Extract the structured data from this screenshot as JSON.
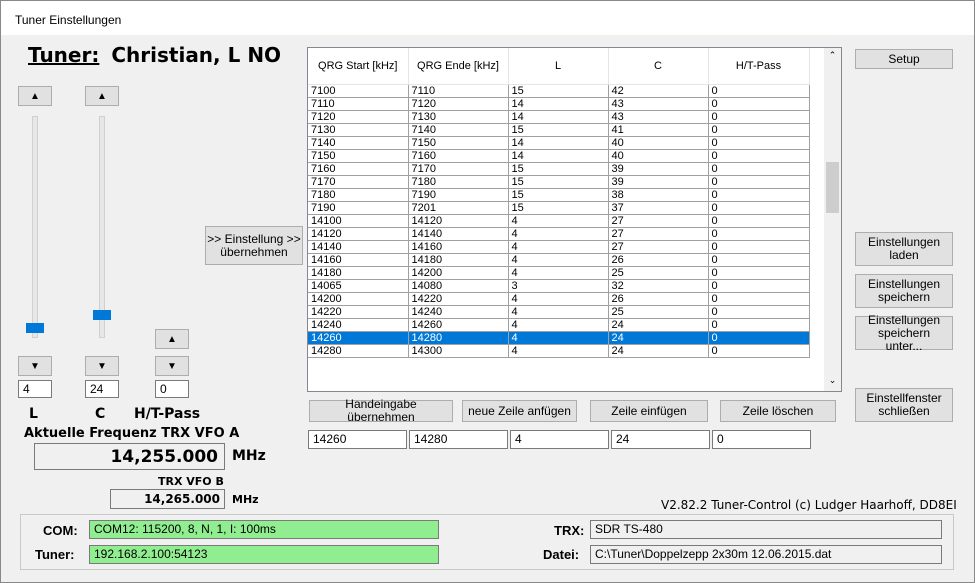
{
  "window": {
    "title": "Tuner Einstellungen"
  },
  "tuner": {
    "label": "Tuner:",
    "name": "Christian, L NO"
  },
  "sliders": {
    "l_value": "4",
    "c_value": "24",
    "htpass_value": "0",
    "l_label": "L",
    "c_label": "C",
    "htpass_label": "H/T-Pass",
    "up_glyph": "▲",
    "down_glyph": "▼"
  },
  "frequency": {
    "vfo_a_label": "Aktuelle Frequenz TRX VFO A",
    "vfo_a_value": "14,255.000",
    "vfo_a_unit": "MHz",
    "vfo_b_label": "TRX VFO B",
    "vfo_b_value": "14,265.000",
    "vfo_b_unit": "MHz"
  },
  "buttons": {
    "apply_setting": ">> Einstellung >> übernehmen",
    "setup": "Setup",
    "load_settings": "Einstellungen laden",
    "save_settings": "Einstellungen speichern",
    "save_settings_as": "Einstellungen speichern unter...",
    "close_window": "Einstellfenster schließen",
    "apply_manual": "Handeingabe übernehmen",
    "append_row": "neue Zeile anfügen",
    "insert_row": "Zeile einfügen",
    "delete_row": "Zeile löschen"
  },
  "table": {
    "columns": [
      "QRG Start [kHz]",
      "QRG Ende [kHz]",
      "L",
      "C",
      "H/T-Pass"
    ],
    "rows": [
      [
        "7100",
        "7110",
        "15",
        "42",
        "0"
      ],
      [
        "7110",
        "7120",
        "14",
        "43",
        "0"
      ],
      [
        "7120",
        "7130",
        "14",
        "43",
        "0"
      ],
      [
        "7130",
        "7140",
        "15",
        "41",
        "0"
      ],
      [
        "7140",
        "7150",
        "14",
        "40",
        "0"
      ],
      [
        "7150",
        "7160",
        "14",
        "40",
        "0"
      ],
      [
        "7160",
        "7170",
        "15",
        "39",
        "0"
      ],
      [
        "7170",
        "7180",
        "15",
        "39",
        "0"
      ],
      [
        "7180",
        "7190",
        "15",
        "38",
        "0"
      ],
      [
        "7190",
        "7201",
        "15",
        "37",
        "0"
      ],
      [
        "14100",
        "14120",
        "4",
        "27",
        "0"
      ],
      [
        "14120",
        "14140",
        "4",
        "27",
        "0"
      ],
      [
        "14140",
        "14160",
        "4",
        "27",
        "0"
      ],
      [
        "14160",
        "14180",
        "4",
        "26",
        "0"
      ],
      [
        "14180",
        "14200",
        "4",
        "25",
        "0"
      ],
      [
        "14065",
        "14080",
        "3",
        "32",
        "0"
      ],
      [
        "14200",
        "14220",
        "4",
        "26",
        "0"
      ],
      [
        "14220",
        "14240",
        "4",
        "25",
        "0"
      ],
      [
        "14240",
        "14260",
        "4",
        "24",
        "0"
      ],
      [
        "14260",
        "14280",
        "4",
        "24",
        "0"
      ],
      [
        "14280",
        "14300",
        "4",
        "24",
        "0"
      ]
    ],
    "selected_row": 19
  },
  "edit_row": [
    "14260",
    "14280",
    "4",
    "24",
    "0"
  ],
  "version": "V2.82.2 Tuner-Control (c) Ludger Haarhoff, DD8EI",
  "status": {
    "com_label": "COM:",
    "com_value": "COM12: 115200, 8, N, 1,  I: 100ms",
    "tuner_label": "Tuner:",
    "tuner_value": "192.168.2.100:54123",
    "trx_label": "TRX:",
    "trx_value": "SDR TS-480",
    "file_label": "Datei:",
    "file_value": "C:\\Tuner\\Doppelzepp 2x30m 12.06.2015.dat"
  },
  "colors": {
    "selection": "#0078d7",
    "status_green": "#90ee90",
    "slider_thumb": "#0078d7"
  },
  "icons": {
    "scroll_up": "chevron-up-icon",
    "scroll_down": "chevron-down-icon"
  }
}
